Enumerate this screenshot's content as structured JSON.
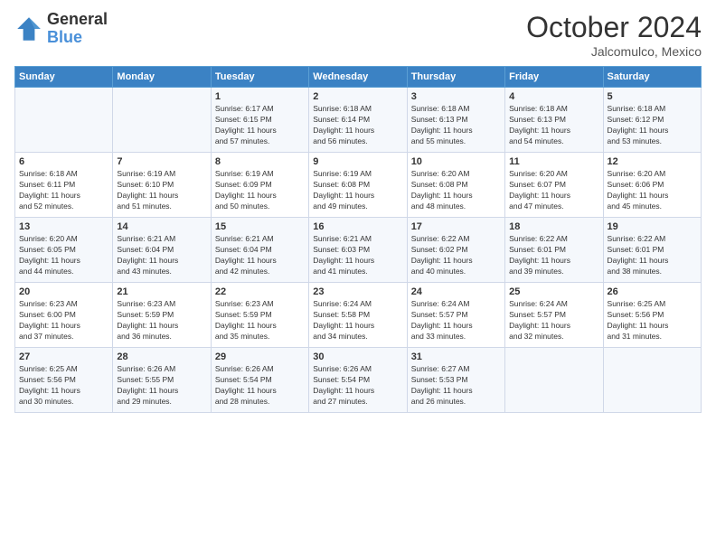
{
  "header": {
    "logo_general": "General",
    "logo_blue": "Blue",
    "month": "October 2024",
    "location": "Jalcomulco, Mexico"
  },
  "weekdays": [
    "Sunday",
    "Monday",
    "Tuesday",
    "Wednesday",
    "Thursday",
    "Friday",
    "Saturday"
  ],
  "weeks": [
    [
      {
        "day": "",
        "info": ""
      },
      {
        "day": "",
        "info": ""
      },
      {
        "day": "1",
        "info": "Sunrise: 6:17 AM\nSunset: 6:15 PM\nDaylight: 11 hours\nand 57 minutes."
      },
      {
        "day": "2",
        "info": "Sunrise: 6:18 AM\nSunset: 6:14 PM\nDaylight: 11 hours\nand 56 minutes."
      },
      {
        "day": "3",
        "info": "Sunrise: 6:18 AM\nSunset: 6:13 PM\nDaylight: 11 hours\nand 55 minutes."
      },
      {
        "day": "4",
        "info": "Sunrise: 6:18 AM\nSunset: 6:13 PM\nDaylight: 11 hours\nand 54 minutes."
      },
      {
        "day": "5",
        "info": "Sunrise: 6:18 AM\nSunset: 6:12 PM\nDaylight: 11 hours\nand 53 minutes."
      }
    ],
    [
      {
        "day": "6",
        "info": "Sunrise: 6:18 AM\nSunset: 6:11 PM\nDaylight: 11 hours\nand 52 minutes."
      },
      {
        "day": "7",
        "info": "Sunrise: 6:19 AM\nSunset: 6:10 PM\nDaylight: 11 hours\nand 51 minutes."
      },
      {
        "day": "8",
        "info": "Sunrise: 6:19 AM\nSunset: 6:09 PM\nDaylight: 11 hours\nand 50 minutes."
      },
      {
        "day": "9",
        "info": "Sunrise: 6:19 AM\nSunset: 6:08 PM\nDaylight: 11 hours\nand 49 minutes."
      },
      {
        "day": "10",
        "info": "Sunrise: 6:20 AM\nSunset: 6:08 PM\nDaylight: 11 hours\nand 48 minutes."
      },
      {
        "day": "11",
        "info": "Sunrise: 6:20 AM\nSunset: 6:07 PM\nDaylight: 11 hours\nand 47 minutes."
      },
      {
        "day": "12",
        "info": "Sunrise: 6:20 AM\nSunset: 6:06 PM\nDaylight: 11 hours\nand 45 minutes."
      }
    ],
    [
      {
        "day": "13",
        "info": "Sunrise: 6:20 AM\nSunset: 6:05 PM\nDaylight: 11 hours\nand 44 minutes."
      },
      {
        "day": "14",
        "info": "Sunrise: 6:21 AM\nSunset: 6:04 PM\nDaylight: 11 hours\nand 43 minutes."
      },
      {
        "day": "15",
        "info": "Sunrise: 6:21 AM\nSunset: 6:04 PM\nDaylight: 11 hours\nand 42 minutes."
      },
      {
        "day": "16",
        "info": "Sunrise: 6:21 AM\nSunset: 6:03 PM\nDaylight: 11 hours\nand 41 minutes."
      },
      {
        "day": "17",
        "info": "Sunrise: 6:22 AM\nSunset: 6:02 PM\nDaylight: 11 hours\nand 40 minutes."
      },
      {
        "day": "18",
        "info": "Sunrise: 6:22 AM\nSunset: 6:01 PM\nDaylight: 11 hours\nand 39 minutes."
      },
      {
        "day": "19",
        "info": "Sunrise: 6:22 AM\nSunset: 6:01 PM\nDaylight: 11 hours\nand 38 minutes."
      }
    ],
    [
      {
        "day": "20",
        "info": "Sunrise: 6:23 AM\nSunset: 6:00 PM\nDaylight: 11 hours\nand 37 minutes."
      },
      {
        "day": "21",
        "info": "Sunrise: 6:23 AM\nSunset: 5:59 PM\nDaylight: 11 hours\nand 36 minutes."
      },
      {
        "day": "22",
        "info": "Sunrise: 6:23 AM\nSunset: 5:59 PM\nDaylight: 11 hours\nand 35 minutes."
      },
      {
        "day": "23",
        "info": "Sunrise: 6:24 AM\nSunset: 5:58 PM\nDaylight: 11 hours\nand 34 minutes."
      },
      {
        "day": "24",
        "info": "Sunrise: 6:24 AM\nSunset: 5:57 PM\nDaylight: 11 hours\nand 33 minutes."
      },
      {
        "day": "25",
        "info": "Sunrise: 6:24 AM\nSunset: 5:57 PM\nDaylight: 11 hours\nand 32 minutes."
      },
      {
        "day": "26",
        "info": "Sunrise: 6:25 AM\nSunset: 5:56 PM\nDaylight: 11 hours\nand 31 minutes."
      }
    ],
    [
      {
        "day": "27",
        "info": "Sunrise: 6:25 AM\nSunset: 5:56 PM\nDaylight: 11 hours\nand 30 minutes."
      },
      {
        "day": "28",
        "info": "Sunrise: 6:26 AM\nSunset: 5:55 PM\nDaylight: 11 hours\nand 29 minutes."
      },
      {
        "day": "29",
        "info": "Sunrise: 6:26 AM\nSunset: 5:54 PM\nDaylight: 11 hours\nand 28 minutes."
      },
      {
        "day": "30",
        "info": "Sunrise: 6:26 AM\nSunset: 5:54 PM\nDaylight: 11 hours\nand 27 minutes."
      },
      {
        "day": "31",
        "info": "Sunrise: 6:27 AM\nSunset: 5:53 PM\nDaylight: 11 hours\nand 26 minutes."
      },
      {
        "day": "",
        "info": ""
      },
      {
        "day": "",
        "info": ""
      }
    ]
  ]
}
